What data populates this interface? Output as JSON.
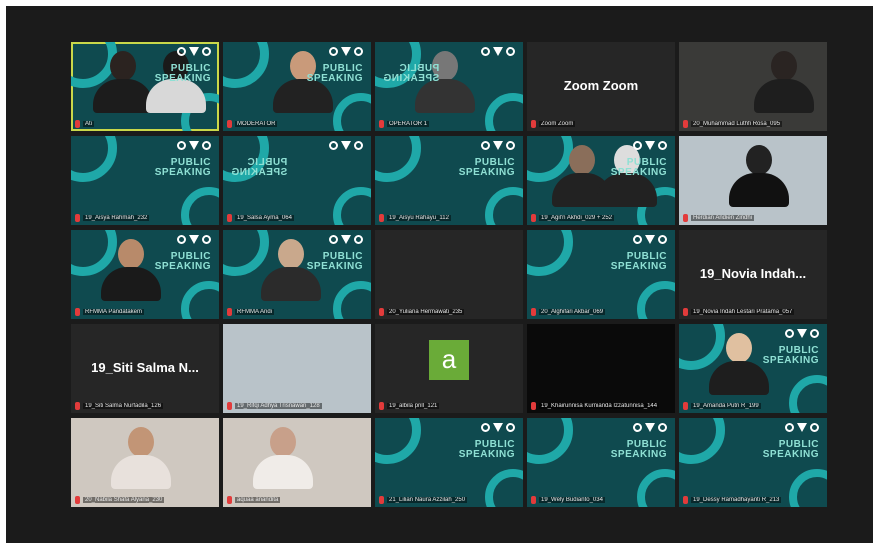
{
  "tiles": [
    {
      "name": "Ati",
      "big": "",
      "style": "brand-active"
    },
    {
      "name": "MODERATOR",
      "big": "",
      "style": "brand"
    },
    {
      "name": "OPERATOR 1",
      "big": "",
      "style": "brand-mirror"
    },
    {
      "name": "Zoom Zoom",
      "big": "Zoom Zoom",
      "style": "dark"
    },
    {
      "name": "20_Muhammad Luthfi Rosa_095",
      "big": "",
      "style": "cam-dark"
    },
    {
      "name": "19_Aisya Rahmah_232",
      "big": "",
      "style": "brand"
    },
    {
      "name": "19_Salsa Ayma_064",
      "big": "",
      "style": "brand-mirror"
    },
    {
      "name": "19_Aisyu Rahayu_112",
      "big": "",
      "style": "brand"
    },
    {
      "name": "19_Agil'n Akhdi_029 + 252",
      "big": "",
      "style": "brand"
    },
    {
      "name": "Herdian Andien Zindhi",
      "big": "",
      "style": "cam-light"
    },
    {
      "name": "RFMMA Pandatakem",
      "big": "",
      "style": "brand"
    },
    {
      "name": "RFMMA Andi",
      "big": "",
      "style": "brand"
    },
    {
      "name": "20_Yuliana Hermawati_235",
      "big": "",
      "style": "dark"
    },
    {
      "name": "20_Alghifari Akbar_069",
      "big": "",
      "style": "brand"
    },
    {
      "name": "19_Novia Indah Lestari Pratama_057",
      "big": "19_Novia Indah...",
      "style": "dark"
    },
    {
      "name": "19_Siti Salma Nurfadila_126",
      "big": "19_Siti Salma N...",
      "style": "dark"
    },
    {
      "name": "19_Rifqi Adhya Trisnawan_128",
      "big": "",
      "style": "cam-wall"
    },
    {
      "name": "19_albila prill_121",
      "big": "",
      "style": "avatar"
    },
    {
      "name": "19_Khairunnisa Kurnianda Izzatunnisa_144",
      "big": "",
      "style": "black"
    },
    {
      "name": "19_Amanda Putri R_199",
      "big": "",
      "style": "brand-photo"
    },
    {
      "name": "20_Nabila Shafa Alyana_230",
      "big": "",
      "style": "cam-warm"
    },
    {
      "name": "aquaa anandita",
      "big": "",
      "style": "cam-warm"
    },
    {
      "name": "21_Lilian Naura Azzilah_250",
      "big": "",
      "style": "brand-small"
    },
    {
      "name": "19_Wely Budianto_034",
      "big": "",
      "style": "brand"
    },
    {
      "name": "19_Dessy Ramadhayanti R_213",
      "big": "",
      "style": "brand"
    }
  ],
  "branding": {
    "line1": "PUBLIC",
    "line2": "SPEAKING"
  },
  "avatar_letter": "a",
  "colors": {
    "brand_bg": "#0f4a4f",
    "accent": "#1fa8a8",
    "active_border": "#c9d84a",
    "mic_off": "#e23b3b"
  },
  "icons": {
    "mic": "mic-off-icon"
  }
}
